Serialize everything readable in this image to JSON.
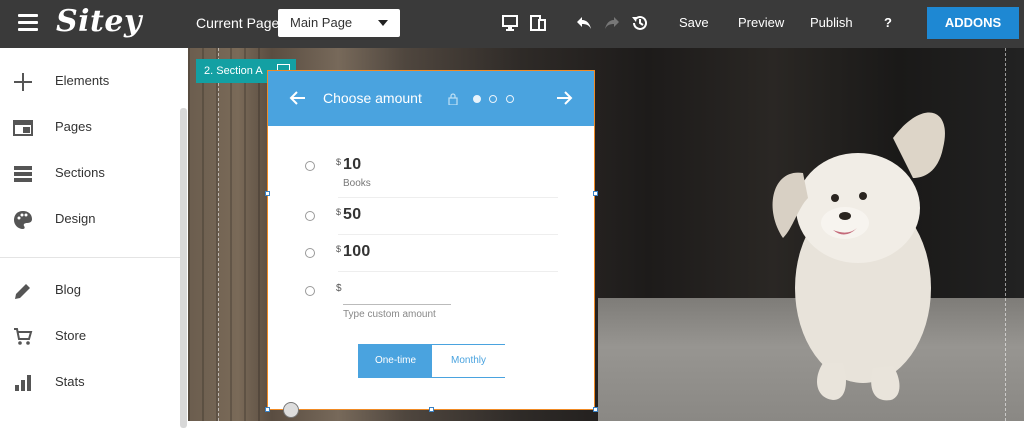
{
  "app": {
    "logo": "Sitey"
  },
  "toolbar": {
    "current_page_label": "Current Page:",
    "page_select_value": "Main Page",
    "save_label": "Save",
    "preview_label": "Preview",
    "publish_label": "Publish",
    "help_label": "?",
    "addons_label": "ADDONS"
  },
  "sidebar": {
    "items": [
      {
        "label": "Elements",
        "icon": "plus-icon"
      },
      {
        "label": "Pages",
        "icon": "pages-icon"
      },
      {
        "label": "Sections",
        "icon": "sections-icon"
      },
      {
        "label": "Design",
        "icon": "palette-icon"
      },
      {
        "label": "Blog",
        "icon": "pencil-icon"
      },
      {
        "label": "Store",
        "icon": "cart-icon"
      },
      {
        "label": "Stats",
        "icon": "stats-icon"
      }
    ]
  },
  "canvas": {
    "section_tag": "2. Section A",
    "widget": {
      "title": "Choose amount",
      "steps_total": 3,
      "steps_active": 1,
      "amounts": [
        {
          "currency": "$",
          "value": "10",
          "note": "Books"
        },
        {
          "currency": "$",
          "value": "50",
          "note": ""
        },
        {
          "currency": "$",
          "value": "100",
          "note": ""
        }
      ],
      "custom": {
        "currency": "$",
        "placeholder": "Type custom amount"
      },
      "frequency": {
        "one_time": "One-time",
        "monthly": "Monthly",
        "selected": "One-time"
      }
    }
  },
  "colors": {
    "topbar": "#3a3a3a",
    "accent": "#1e88d3",
    "widget_header": "#4aa3df",
    "section_tag": "#13a0a3",
    "selection_border": "#f08a24"
  }
}
